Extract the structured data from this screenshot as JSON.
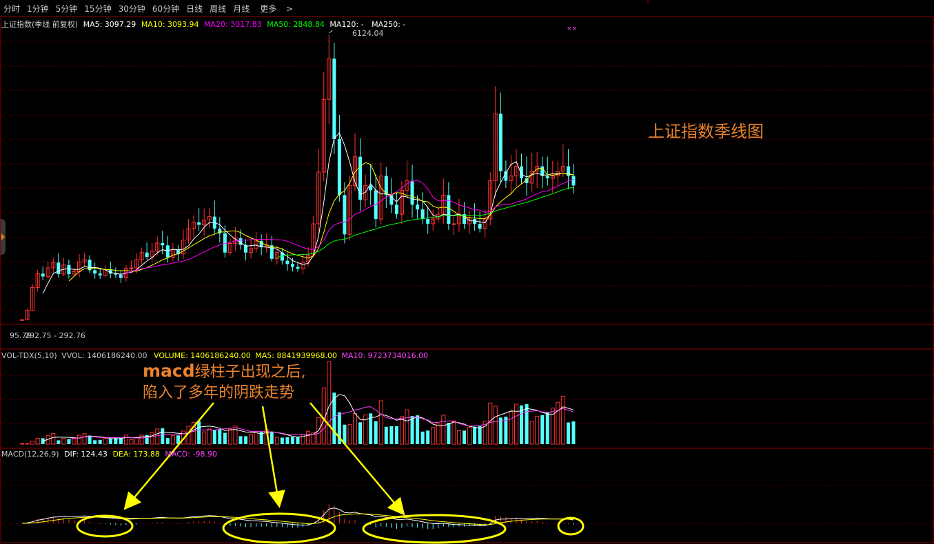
{
  "toolbar": {
    "items": [
      "分时",
      "1分钟",
      "5分钟",
      "15分钟",
      "30分钟",
      "60分钟",
      "日线",
      "周线",
      "月线",
      "更多"
    ],
    "more_icon": "chevron-right-icon"
  },
  "main": {
    "title": "上证指数(季线 前复权)",
    "ma": [
      {
        "label": "MA5: 3097.29",
        "color": "#ffffff"
      },
      {
        "label": "MA10: 3093.94",
        "color": "#ffff00"
      },
      {
        "label": "MA20: 3017.83",
        "color": "#ff00ff"
      },
      {
        "label": "MA50: 2848.84",
        "color": "#00ff00"
      },
      {
        "label": "MA120: -",
        "color": "#ffffff"
      },
      {
        "label": "MA250: -",
        "color": "#ffffff"
      }
    ],
    "high_label": "6124.04",
    "low_label": "95.79",
    "range_label": "292.75 - 292.76",
    "annotation": "上证指数季线图",
    "marker": "××"
  },
  "volume": {
    "title": "VOL-TDX(5,10)",
    "vvol": "VVOL: 1406186240.00",
    "volume": "VOLUME: 1406186240.00",
    "ma5": "MA5: 8841939968.00",
    "ma10": "MA10: 9723734016.00"
  },
  "macd": {
    "title": "MACD(12,26,9)",
    "dif": "DIF: 124.43",
    "dea": "DEA: 173.88",
    "macd": "MACD: -98.90"
  },
  "annotation": {
    "line1_prefix": "macd",
    "line1_rest": "绿柱子出现之后,",
    "line2": "陷入了多年的阴跌走势"
  },
  "colors": {
    "up": "#ff3232",
    "down": "#54ffff",
    "ma5": "#ffffff",
    "ma10": "#ffff00",
    "ma20": "#ff00ff",
    "ma50": "#00ff00",
    "grid": "#8b0000",
    "annotation": "#e8822e",
    "highlight": "#ffff00"
  },
  "chart_data": {
    "type": "candlestick",
    "price_close": [
      96,
      293,
      770,
      1060,
      1000,
      1180,
      1290,
      1050,
      1240,
      1050,
      1100,
      1300,
      1350,
      1130,
      1060,
      1020,
      1140,
      1060,
      1040,
      970,
      1170,
      1180,
      1350,
      1500,
      1410,
      1530,
      1700,
      1650,
      1400,
      1560,
      1470,
      1760,
      2000,
      2130,
      2080,
      2180,
      2250,
      2000,
      1900,
      1500,
      1690,
      1800,
      1660,
      1500,
      1580,
      1740,
      1610,
      1650,
      1370,
      1500,
      1330,
      1260,
      1200,
      1160,
      1300,
      1450,
      2100,
      3180,
      4700,
      5550,
      3870,
      2700,
      1880,
      2900,
      3500,
      2600,
      2900,
      2800,
      2200,
      3100,
      2700,
      2500,
      2300,
      2800,
      3000,
      2500,
      2400,
      2200,
      2100,
      2200,
      2300,
      2700,
      2100,
      2100,
      2300,
      2100,
      2200,
      2100,
      2000,
      2200,
      3000,
      4400,
      3200,
      3000,
      3100,
      3300,
      3050,
      2950,
      3200,
      3300,
      3100,
      3050,
      3100,
      3200,
      3300,
      3100,
      2900
    ],
    "vol_ma5_label": "8841939968.00",
    "vol_ma10_label": "9723734016.00",
    "macd_dif": 124.43,
    "macd_dea": 173.88,
    "macd_value": -98.9
  }
}
